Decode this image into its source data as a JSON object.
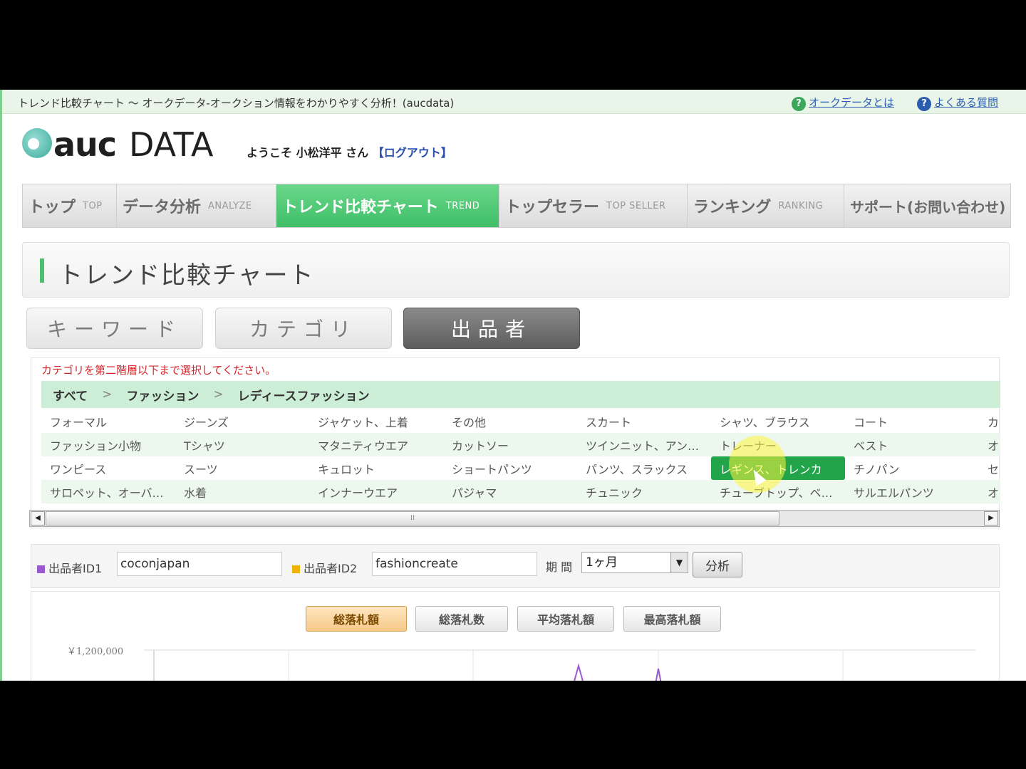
{
  "window": {
    "title": "トレンド比較チャート ～ オークデータ-オークション情報をわかりやすく分析！(aucdata)",
    "links": [
      {
        "label": "オークデータとは",
        "icon": "question-icon"
      },
      {
        "label": "よくある質問",
        "icon": "help-icon"
      }
    ]
  },
  "header": {
    "logo_auc": "auc",
    "logo_data": "DATA",
    "welcome": "ようこそ 小松洋平 さん",
    "logout": "【ログアウト】"
  },
  "nav": [
    {
      "jp": "トップ",
      "en": "TOP"
    },
    {
      "jp": "データ分析",
      "en": "ANALYZE"
    },
    {
      "jp": "トレンド比較チャート",
      "en": "TREND"
    },
    {
      "jp": "トップセラー",
      "en": "TOP SELLER"
    },
    {
      "jp": "ランキング",
      "en": "RANKING"
    },
    {
      "jp": "サポート(お問い合わせ)",
      "en": ""
    }
  ],
  "page": {
    "heading": "トレンド比較チャート"
  },
  "subtabs": [
    "キーワード",
    "カテゴリ",
    "出品者"
  ],
  "category": {
    "notice": "カテゴリを第二階層以下まで選択してください。",
    "breadcrumb": [
      "すべて",
      "ファッション",
      "レディースファッション"
    ],
    "rows": [
      [
        "フォーマル",
        "ジーンズ",
        "ジャケット、上着",
        "その他",
        "スカート",
        "シャツ、ブラウス",
        "コート",
        "カ"
      ],
      [
        "ファッション小物",
        "Tシャツ",
        "マタニティウエア",
        "カットソー",
        "ツインニット、アン…",
        "トレーナー",
        "ベスト",
        "オ"
      ],
      [
        "ワンピース",
        "スーツ",
        "キュロット",
        "ショートパンツ",
        "パンツ、スラックス",
        "レギンス、トレンカ",
        "チノパン",
        "セ"
      ],
      [
        "サロペット、オーバ…",
        "水着",
        "インナーウエア",
        "パジャマ",
        "チュニック",
        "チューブトップ、ベ…",
        "サルエルパンツ",
        "オ"
      ]
    ],
    "selected": "レギンス、トレンカ"
  },
  "seller": {
    "label1": "出品者ID1",
    "value1": "coconjapan",
    "label2": "出品者ID2",
    "value2": "fashioncreate",
    "period_label": "期 間",
    "period_value": "1ヶ月",
    "analyze_label": "分析"
  },
  "metrics": [
    "総落札額",
    "総落札数",
    "平均落札額",
    "最高落札額"
  ],
  "chart_data": {
    "type": "line",
    "title": "",
    "xlabel": "",
    "ylabel": "",
    "y_tick_labels": [
      "￥1,200,000"
    ],
    "series": [
      {
        "color": "#9b59d0",
        "values": []
      },
      {
        "color": "#f0b400",
        "values": []
      }
    ]
  },
  "colors": {
    "accent": "#3fbf68",
    "seller1": "#9b59d0",
    "seller2": "#f0b400",
    "notice": "#d3262c"
  }
}
